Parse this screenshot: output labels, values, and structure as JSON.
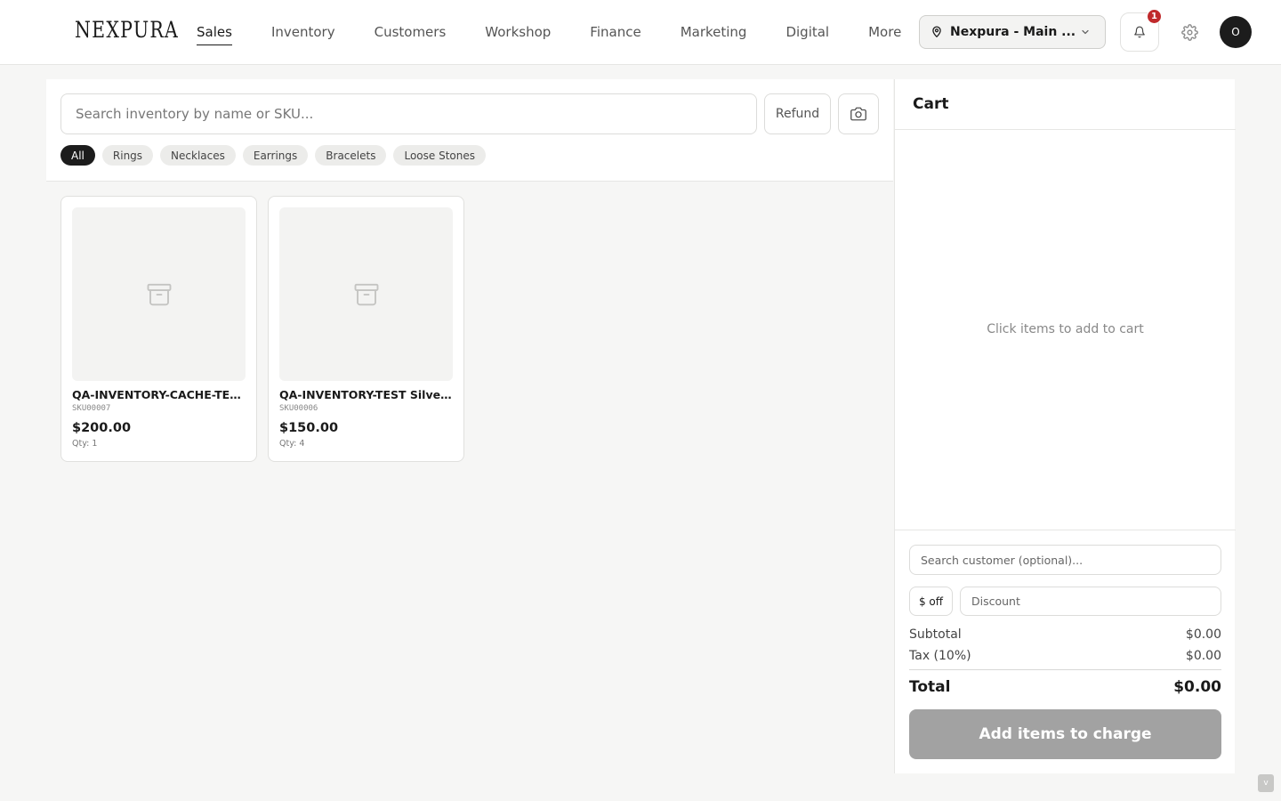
{
  "brand": {
    "logo_text": "NEXPURA"
  },
  "nav": {
    "items": [
      {
        "label": "Sales",
        "active": true
      },
      {
        "label": "Inventory"
      },
      {
        "label": "Customers"
      },
      {
        "label": "Workshop"
      },
      {
        "label": "Finance"
      },
      {
        "label": "Marketing"
      },
      {
        "label": "Digital"
      },
      {
        "label": "More"
      }
    ]
  },
  "header": {
    "location_label": "Nexpura - Main ...",
    "notification_count": "1",
    "avatar_initial": "O",
    "icons": {
      "location": "map-pin-icon",
      "dropdown": "chevron-down-icon",
      "notifications": "bell-icon",
      "settings": "gear-icon"
    }
  },
  "search": {
    "placeholder": "Search inventory by name or SKU...",
    "refund_label": "Refund",
    "camera_icon": "camera-icon"
  },
  "categories": [
    "All",
    "Rings",
    "Necklaces",
    "Earrings",
    "Bracelets",
    "Loose Stones"
  ],
  "products": [
    {
      "name": "QA-INVENTORY-CACHE-TES...",
      "sku": "SKU00007",
      "price": "$200.00",
      "qty": "Qty: 1",
      "icon": "archive-box-icon"
    },
    {
      "name": "QA-INVENTORY-TEST Silver...",
      "sku": "SKU00006",
      "price": "$150.00",
      "qty": "Qty: 4",
      "icon": "archive-box-icon"
    }
  ],
  "cart": {
    "title": "Cart",
    "empty_message": "Click items to add to cart",
    "customer_placeholder": "Search customer (optional)...",
    "discount_type": "$ off",
    "discount_placeholder": "Discount",
    "subtotal_label": "Subtotal",
    "subtotal_value": "$0.00",
    "tax_label": "Tax (10%)",
    "tax_value": "$0.00",
    "total_label": "Total",
    "total_value": "$0.00",
    "charge_label": "Add items to charge"
  },
  "misc": {
    "corner_label": "v"
  },
  "colors": {
    "accent_dark": "#1c1c1c",
    "badge_red": "#c0292b",
    "charge_disabled": "#a2a2a2",
    "background": "#f6f6f5"
  }
}
